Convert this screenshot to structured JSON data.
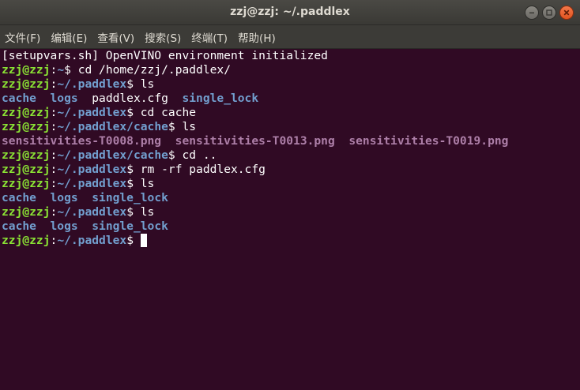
{
  "window": {
    "title": "zzj@zzj: ~/.paddlex",
    "controls": {
      "minimize": "minimize-icon",
      "maximize": "maximize-icon",
      "close": "close-icon"
    }
  },
  "menu": {
    "file": "文件(F)",
    "edit": "编辑(E)",
    "view": "查看(V)",
    "search": "搜索(S)",
    "terminal": "终端(T)",
    "help": "帮助(H)"
  },
  "colors": {
    "background": "#300a24",
    "prompt_user": "#8ae234",
    "prompt_path": "#729fcf",
    "directory": "#729fcf",
    "image_file": "#ad7fa8",
    "text": "#ffffff"
  },
  "terminal": {
    "lines": [
      {
        "type": "output",
        "segments": [
          {
            "text": "[setupvars.sh] OpenVINO environment initialized",
            "cls": "plain"
          }
        ]
      },
      {
        "type": "prompt",
        "user": "zzj@zzj",
        "path": "~",
        "command": "cd /home/zzj/.paddlex/"
      },
      {
        "type": "prompt",
        "user": "zzj@zzj",
        "path": "~/.paddlex",
        "command": "ls"
      },
      {
        "type": "output",
        "segments": [
          {
            "text": "cache",
            "cls": "dir"
          },
          {
            "text": "  ",
            "cls": "plain"
          },
          {
            "text": "logs",
            "cls": "dir"
          },
          {
            "text": "  ",
            "cls": "plain"
          },
          {
            "text": "paddlex.cfg",
            "cls": "plain"
          },
          {
            "text": "  ",
            "cls": "plain"
          },
          {
            "text": "single_lock",
            "cls": "dir"
          }
        ]
      },
      {
        "type": "prompt",
        "user": "zzj@zzj",
        "path": "~/.paddlex",
        "command": "cd cache"
      },
      {
        "type": "prompt",
        "user": "zzj@zzj",
        "path": "~/.paddlex/cache",
        "command": "ls"
      },
      {
        "type": "output",
        "segments": [
          {
            "text": "sensitivities-T0008.png",
            "cls": "img"
          },
          {
            "text": "  ",
            "cls": "plain"
          },
          {
            "text": "sensitivities-T0013.png",
            "cls": "img"
          },
          {
            "text": "  ",
            "cls": "plain"
          },
          {
            "text": "sensitivities-T0019.png",
            "cls": "img"
          }
        ]
      },
      {
        "type": "prompt",
        "user": "zzj@zzj",
        "path": "~/.paddlex/cache",
        "command": "cd .."
      },
      {
        "type": "prompt",
        "user": "zzj@zzj",
        "path": "~/.paddlex",
        "command": "rm -rf paddlex.cfg"
      },
      {
        "type": "prompt",
        "user": "zzj@zzj",
        "path": "~/.paddlex",
        "command": "ls"
      },
      {
        "type": "output",
        "segments": [
          {
            "text": "cache",
            "cls": "dir"
          },
          {
            "text": "  ",
            "cls": "plain"
          },
          {
            "text": "logs",
            "cls": "dir"
          },
          {
            "text": "  ",
            "cls": "plain"
          },
          {
            "text": "single_lock",
            "cls": "dir"
          }
        ]
      },
      {
        "type": "prompt",
        "user": "zzj@zzj",
        "path": "~/.paddlex",
        "command": "ls"
      },
      {
        "type": "output",
        "segments": [
          {
            "text": "cache",
            "cls": "dir"
          },
          {
            "text": "  ",
            "cls": "plain"
          },
          {
            "text": "logs",
            "cls": "dir"
          },
          {
            "text": "  ",
            "cls": "plain"
          },
          {
            "text": "single_lock",
            "cls": "dir"
          }
        ]
      },
      {
        "type": "prompt",
        "user": "zzj@zzj",
        "path": "~/.paddlex",
        "command": "",
        "cursor": true
      }
    ]
  }
}
